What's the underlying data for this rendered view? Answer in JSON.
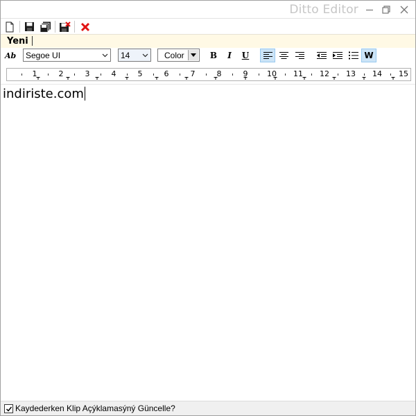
{
  "window": {
    "title": "Ditto Editor",
    "controls": {
      "minimize": "minimize",
      "maximize": "restore",
      "close": "close"
    }
  },
  "toolbar": {
    "buttons": [
      {
        "name": "new",
        "icon": "new-document-icon"
      },
      {
        "name": "save",
        "icon": "save-icon"
      },
      {
        "name": "save-all",
        "icon": "save-all-icon"
      },
      {
        "name": "save-close",
        "icon": "save-close-icon"
      },
      {
        "name": "close",
        "icon": "red-x-icon"
      }
    ],
    "close_color": "#e11414"
  },
  "tabs": [
    {
      "label": "Yeni"
    }
  ],
  "format": {
    "font": "Segoe UI",
    "size": "14",
    "color_label": "Color",
    "bold": "B",
    "italic": "I",
    "underline": "U",
    "word_wrap": "W",
    "active_align": "left",
    "accent": "#cce4f7"
  },
  "ruler": {
    "numbers": [
      "1",
      "2",
      "3",
      "4",
      "5",
      "6",
      "7",
      "8",
      "9",
      "10",
      "11",
      "12",
      "13",
      "14",
      "15"
    ]
  },
  "editor": {
    "text": "indiriste.com"
  },
  "status": {
    "checkbox_checked": true,
    "label": "Kaydederken Klip Açýklamasýný Güncelle?"
  }
}
